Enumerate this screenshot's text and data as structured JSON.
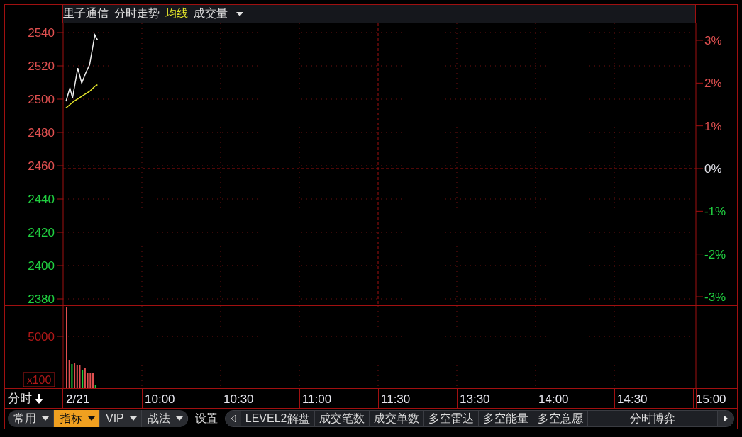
{
  "header": {
    "title": "里子通信",
    "view": "分时走势",
    "legend": [
      {
        "label": "均线",
        "color": "#e6e62a"
      },
      {
        "label": "成交量",
        "color": "#e0e0e0"
      }
    ]
  },
  "price_chart": {
    "price_axis": [
      {
        "label": "2540",
        "kind": "up"
      },
      {
        "label": "2520",
        "kind": "up"
      },
      {
        "label": "2500",
        "kind": "up"
      },
      {
        "label": "2480",
        "kind": "up"
      },
      {
        "label": "2460",
        "kind": "up"
      },
      {
        "label": "2440",
        "kind": "down"
      },
      {
        "label": "2420",
        "kind": "down"
      },
      {
        "label": "2400",
        "kind": "down"
      },
      {
        "label": "2380",
        "kind": "down"
      }
    ],
    "percent_axis": [
      {
        "label": "3%",
        "kind": "up"
      },
      {
        "label": "2%",
        "kind": "up"
      },
      {
        "label": "1%",
        "kind": "up"
      },
      {
        "label": "0%",
        "kind": "flat"
      },
      {
        "label": "-1%",
        "kind": "down"
      },
      {
        "label": "-2%",
        "kind": "down"
      },
      {
        "label": "-3%",
        "kind": "down"
      }
    ]
  },
  "volume_chart": {
    "unit": "x100",
    "axis_label": "5000"
  },
  "time_axis": {
    "label": "分时",
    "ticks": [
      "2/21",
      "10:00",
      "10:30",
      "11:00",
      "11:30",
      "13:30",
      "14:00",
      "14:30",
      "15:00"
    ]
  },
  "toolbar": {
    "menus": [
      {
        "label": "常用",
        "selected": false
      },
      {
        "label": "指标",
        "selected": true
      },
      {
        "label": "VIP",
        "selected": false
      },
      {
        "label": "战法",
        "selected": false
      }
    ],
    "settings": "设置",
    "tabs": [
      "LEVEL2解盘",
      "成交笔数",
      "成交单数",
      "多空雷达",
      "多空能量",
      "多空意愿",
      "分时博弈"
    ]
  }
}
